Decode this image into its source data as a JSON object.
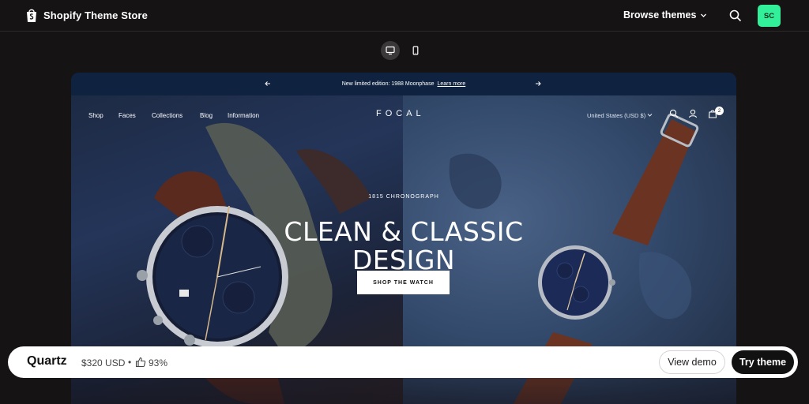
{
  "header": {
    "title": "Shopify Theme Store",
    "browse_label": "Browse themes",
    "avatar_initials": "SC",
    "avatar_color": "#32f09a"
  },
  "device_toggle": {
    "options": [
      "desktop",
      "mobile"
    ],
    "selected": "desktop"
  },
  "preview": {
    "announcement": {
      "text": "New limited edition: 1988 Moonphase",
      "link": "Learn more"
    },
    "nav": {
      "links": [
        "Shop",
        "Faces",
        "Collections",
        "Blog",
        "Information"
      ],
      "brand": "FOCAL",
      "region": "United States (USD $)",
      "cart_count": "2"
    },
    "hero": {
      "eyebrow": "1815 CHRONOGRAPH",
      "headline_line1": "CLEAN & CLASSIC",
      "headline_line2": "DESIGN",
      "button": "SHOP THE WATCH"
    }
  },
  "theme_bar": {
    "name": "Quartz",
    "price": "$320 USD",
    "rating": "93%",
    "view_demo": "View demo",
    "try_theme": "Try theme"
  },
  "icons": [
    "shopify-bag-icon",
    "chevron-down-icon",
    "search-icon",
    "desktop-icon",
    "mobile-icon",
    "arrow-left-icon",
    "arrow-right-icon",
    "account-icon",
    "cart-icon",
    "thumbs-up-icon"
  ]
}
